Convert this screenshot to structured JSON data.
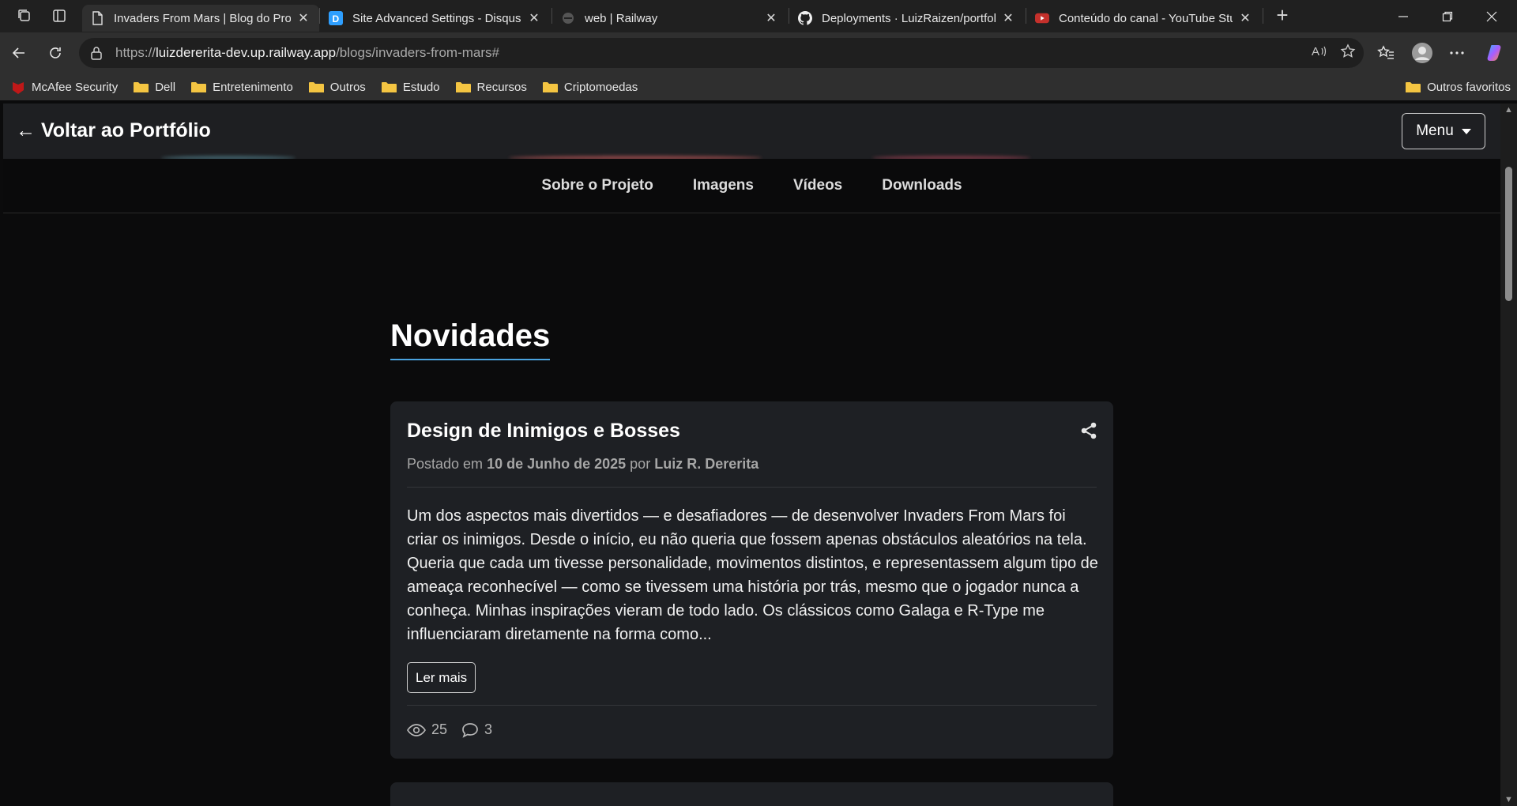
{
  "browser": {
    "tabs": [
      {
        "title": "Invaders From Mars | Blog do Proj",
        "icon": "page-icon",
        "active": true
      },
      {
        "title": "Site Advanced Settings - Disqus A",
        "icon": "disqus-icon",
        "active": false
      },
      {
        "title": "web | Railway",
        "icon": "railway-icon",
        "active": false
      },
      {
        "title": "Deployments · LuizRaizen/portfoli",
        "icon": "github-icon",
        "active": false
      },
      {
        "title": "Conteúdo do canal - YouTube Stu",
        "icon": "youtube-icon",
        "active": false
      }
    ],
    "close_glyph": "✕",
    "new_tab_glyph": "+",
    "address": {
      "scheme": "https://",
      "host": "luizdererita-dev.up.railway.app",
      "path": "/blogs/invaders-from-mars#"
    },
    "bookmarks": [
      "McAfee Security",
      "Dell",
      "Entretenimento",
      "Outros",
      "Estudo",
      "Recursos",
      "Criptomoedas"
    ],
    "other_bookmarks": "Outros favoritos",
    "accent_color": "#4aa3df"
  },
  "page": {
    "back_link": "← Voltar ao Portfólio",
    "menu_label": "Menu",
    "subnav": [
      "Sobre o Projeto",
      "Imagens",
      "Vídeos",
      "Downloads"
    ],
    "section_title": "Novidades",
    "post": {
      "title": "Design de Inimigos e Bosses",
      "meta_prefix": "Postado em",
      "date": "10 de Junho de 2025",
      "meta_by": "por",
      "author": "Luiz R. Dererita",
      "excerpt": "Um dos aspectos mais divertidos — e desafiadores — de desenvolver Invaders From Mars foi criar os inimigos. Desde o início, eu não queria que fossem apenas obstáculos aleatórios na tela. Queria que cada um tivesse personalidade, movimentos distintos, e representassem algum tipo de ameaça reconhecível — como se tivessem uma história por trás, mesmo que o jogador nunca a conheça. Minhas inspirações vieram de todo lado. Os clássicos como Galaga e R-Type me influenciaram diretamente na forma como...",
      "read_more": "Ler mais",
      "views": "25",
      "comments": "3"
    }
  }
}
